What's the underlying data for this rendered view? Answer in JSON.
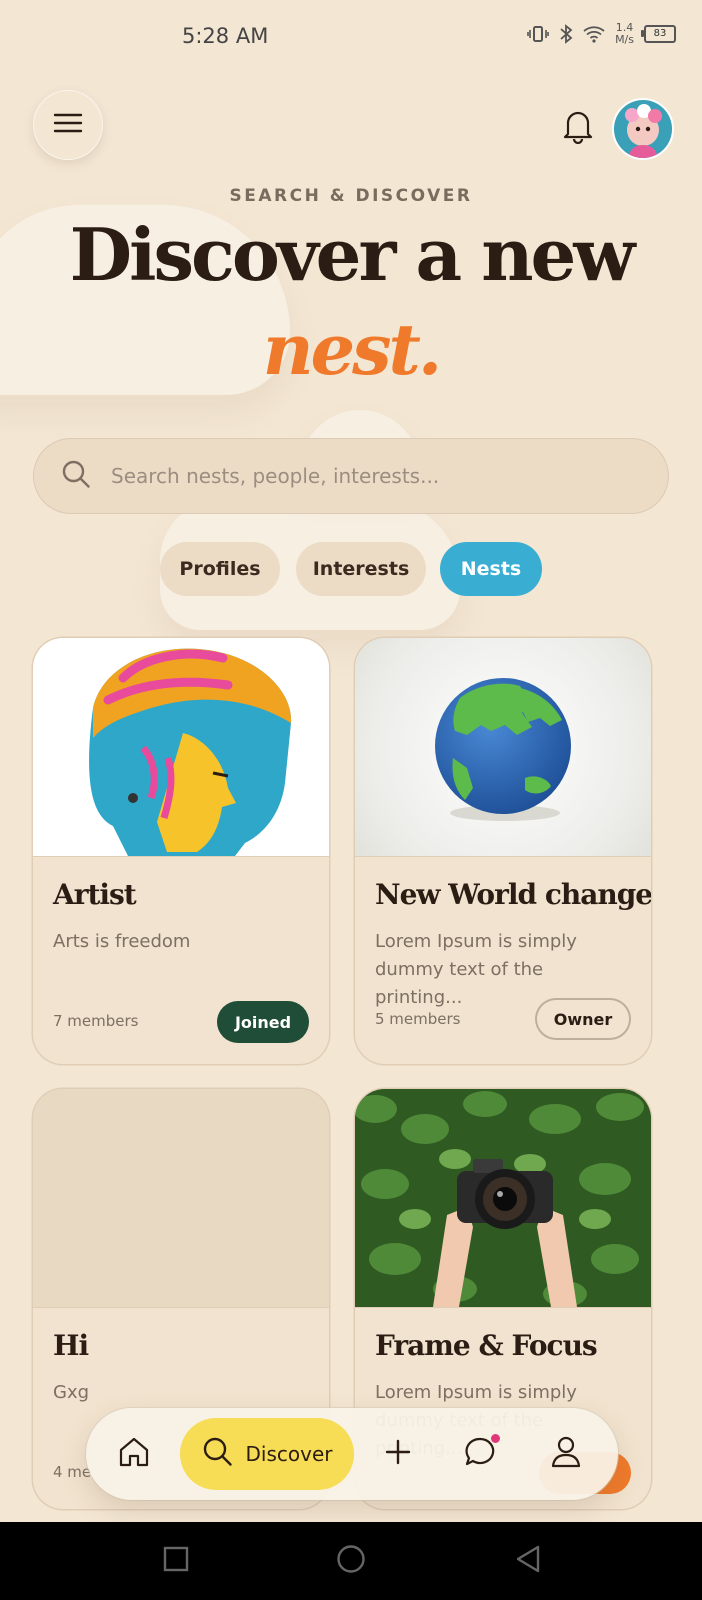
{
  "status_bar": {
    "time": "5:28 AM",
    "net_speed_value": "1.4",
    "net_speed_unit": "M/s",
    "battery": "83"
  },
  "header": {
    "menu_icon": "hamburger-icon",
    "bell_icon": "bell-icon",
    "avatar_icon": "avatar"
  },
  "hero": {
    "kicker": "SEARCH & DISCOVER",
    "headline": "Discover a new",
    "headline_accent": "nest."
  },
  "search": {
    "placeholder": "Search nests, people, interests..."
  },
  "tabs": [
    {
      "label": "Profiles",
      "active": false
    },
    {
      "label": "Interests",
      "active": false
    },
    {
      "label": "Nests",
      "active": true
    }
  ],
  "cards": [
    {
      "title": "Artist",
      "description": "Arts is freedom",
      "members": "7 members",
      "action": "Joined"
    },
    {
      "title": "New World change",
      "description": "Lorem Ipsum is simply dummy text of the printing...",
      "members": "5 members",
      "action": "Owner"
    },
    {
      "title": "Hi",
      "description": "Gxg",
      "members": "4 me",
      "action": ""
    },
    {
      "title": "Frame & Focus",
      "description": "Lorem Ipsum is simply dummy text of the printing...",
      "members": "",
      "action": ""
    }
  ],
  "bottom_nav": {
    "items": [
      {
        "name": "home",
        "icon": "home-icon"
      },
      {
        "name": "discover",
        "icon": "search-icon",
        "label": "Discover",
        "active": true
      },
      {
        "name": "create",
        "icon": "plus-icon"
      },
      {
        "name": "messages",
        "icon": "chat-icon"
      },
      {
        "name": "profile",
        "icon": "user-icon"
      }
    ]
  },
  "colors": {
    "background": "#f3e6d3",
    "accent_orange": "#f07a2b",
    "tab_active": "#3aaed2",
    "joined_green": "#1f4d37",
    "discover_yellow": "#f7dc55"
  }
}
